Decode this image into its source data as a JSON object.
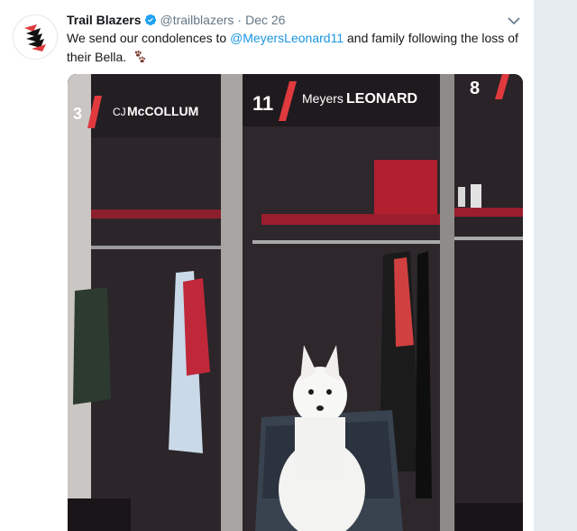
{
  "tweet": {
    "author_name": "Trail Blazers",
    "handle": "@trailblazers",
    "separator": "·",
    "date": "Dec 26",
    "text_before": "We send our condolences to ",
    "mention": "@MeyersLeonard11",
    "text_after": " and family following the loss of their Bella.",
    "emoji": "paw-prints-icon"
  },
  "photo": {
    "locker_left_number": "3",
    "locker_left_name_prefix": "CJ",
    "locker_left_name": "McCOLLUM",
    "locker_center_number": "11",
    "locker_center_name_prefix": "Meyers",
    "locker_center_name": "LEONARD",
    "locker_right_number": "8"
  },
  "colors": {
    "link": "#1b95e0",
    "verified": "#1da1f2",
    "brand_red": "#e03a3e",
    "text": "#14171a",
    "muted": "#657786"
  }
}
